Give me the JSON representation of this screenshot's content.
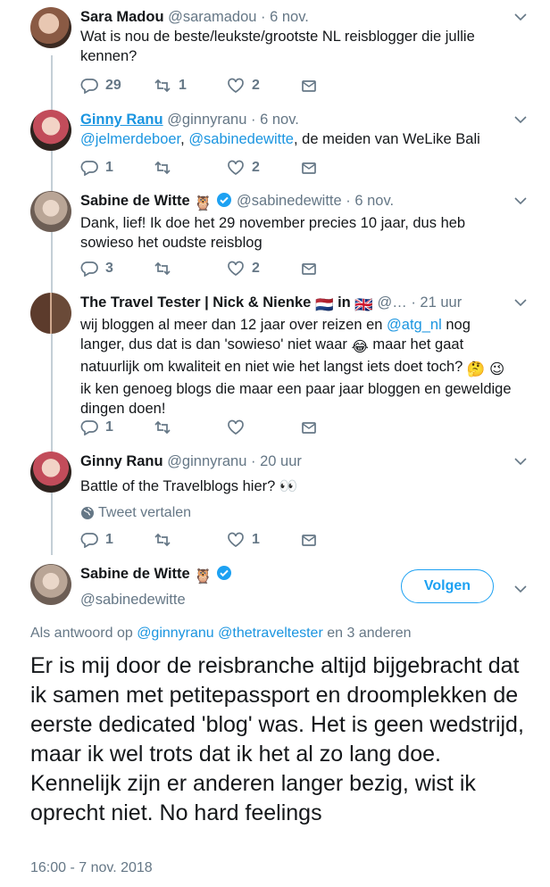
{
  "tweets": [
    {
      "name": "Sara Madou",
      "handle": "@saramadou",
      "time": "6 nov.",
      "text": "Wat is nou de beste/leukste/grootste NL reisblogger die jullie kennen?",
      "replies": "29",
      "retweets": "1",
      "likes": "2"
    },
    {
      "name": "Ginny Ranu",
      "handle": "@ginnyranu",
      "time": "6 nov.",
      "mention1": "@jelmerdeboer",
      "sep": ", ",
      "mention2": "@sabinedewitte",
      "rest": ", de meiden van WeLike Bali",
      "replies": "1",
      "retweets": "",
      "likes": "2"
    },
    {
      "name": "Sabine de Witte",
      "name_emoji": "🦉",
      "handle": "@sabinedewitte",
      "time": "6 nov.",
      "text": "Dank, lief! Ik doe het 29 november precies 10 jaar, dus heb sowieso het oudste reisblog",
      "replies": "3",
      "retweets": "",
      "likes": "2"
    },
    {
      "name": "The Travel Tester | Nick & Nienke",
      "flag1": "🇳🇱",
      "in": "in",
      "flag2": "🇬🇧",
      "handle": "@…",
      "time": "21 uur",
      "text_a": "wij bloggen al meer dan 12 jaar over reizen en ",
      "mention": "@atg_nl",
      "text_b": " nog langer, dus dat is dan 'sowieso' niet waar ",
      "emoji1": "😂",
      "text_c": " maar het gaat natuurlijk om kwaliteit en niet wie het langst iets doet toch? ",
      "emoji2": "🤔",
      "emoji3": "😉",
      "text_d": " ik ken genoeg blogs die maar een paar jaar bloggen en geweldige dingen doen!",
      "replies": "1",
      "retweets": "",
      "likes": ""
    },
    {
      "name": "Ginny Ranu",
      "handle": "@ginnyranu",
      "time": "20 uur",
      "text": "Battle of the Travelblogs hier? 👀",
      "translate": "Tweet vertalen",
      "replies": "1",
      "retweets": "",
      "likes": "1"
    }
  ],
  "main": {
    "name": "Sabine de Witte",
    "name_emoji": "🦉",
    "handle": "@sabinedewitte",
    "follow": "Volgen",
    "reply_prefix": "Als antwoord op ",
    "reply_m1": "@ginnyranu",
    "reply_m2": "@thetraveltester",
    "reply_suffix": " en 3 anderen",
    "text": "Er is mij door de reisbranche altijd bijgebracht dat ik samen met petitepassport en droomplekken de eerste dedicated 'blog' was. Het is geen wedstrijd, maar ik wel trots dat ik het al zo lang doe. Kennelijk zijn er anderen langer bezig, wist ik oprecht niet. No hard feelings",
    "timestamp": "16:00 - 7 nov. 2018"
  },
  "separator": "·",
  "colors": {
    "link": "#1b95e0",
    "muted": "#657786",
    "line": "#c4cfd6",
    "accent": "#1da1f2"
  }
}
